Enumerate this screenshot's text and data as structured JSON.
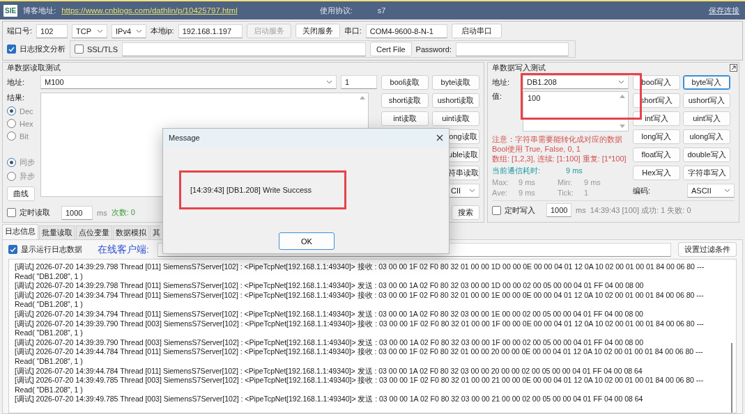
{
  "title_bar": {
    "logo": "SIE",
    "blog_label": "博客地址:",
    "blog_url": "https://www.cnblogs.com/dathlin/p/10425797.html",
    "protocol_label": "使用协议:",
    "protocol": "s7",
    "save_link": "保存连接"
  },
  "connection": {
    "port_label": "端口号:",
    "port": "102",
    "transport": "TCP",
    "ip_version": "IPv4",
    "local_ip_label": "本地ip:",
    "local_ip": "192.168.1.197",
    "buttons": [
      {
        "label": "启动服务",
        "disabled": true
      },
      {
        "label": "关闭服务",
        "disabled": false
      }
    ],
    "serial_label": "串口:",
    "serial": "COM4-9600-8-N-1",
    "serial_button": "启动串口",
    "log_analysis": {
      "label": "日志报文分析",
      "checked": true
    },
    "ssl": {
      "label": "SSL/TLS",
      "checked": false
    },
    "cert_button": "Cert File",
    "password_label": "Password:"
  },
  "read_test": {
    "title": "单数据读取测试",
    "address_label": "地址:",
    "address": "M100",
    "count": "1",
    "result_label": "结果:",
    "formats": [
      {
        "label": "Dec",
        "selected": true
      },
      {
        "label": "Hex",
        "selected": false
      },
      {
        "label": "Bit",
        "selected": false
      }
    ],
    "modes": [
      {
        "label": "同步",
        "selected": true
      },
      {
        "label": "异步",
        "selected": false
      }
    ],
    "curve_button": "曲线",
    "button_rows": [
      [
        "bool读取",
        "byte读取"
      ],
      [
        "short读取",
        "ushort读取"
      ],
      [
        "int读取",
        "uint读取"
      ],
      [
        "ong读取"
      ],
      [
        "uble读取"
      ],
      [
        "符串读取"
      ]
    ],
    "encoding": "CII",
    "timer": {
      "label": "定时读取",
      "checked": false,
      "interval": "1000",
      "unit": "ms",
      "count": "次数: 0"
    },
    "search_button": "搜索"
  },
  "write_test": {
    "title": "单数据写入测试",
    "address_label": "地址:",
    "address": "DB1.208",
    "value_label": "值:",
    "value": "100",
    "notes": [
      "注意：字符串需要能转化成对应的数据",
      "Bool使用 True, False, 0, 1",
      "数组: [1,2,3], 连续: [1:100] 重复: [1*100]"
    ],
    "elapsed_label": "当前通信耗时:",
    "elapsed": "9 ms",
    "stats": [
      {
        "label": "Max:",
        "value": "9 ms"
      },
      {
        "label": "Min:",
        "value": "9 ms"
      },
      {
        "label": "Ave:",
        "value": "9 ms"
      },
      {
        "label": "Tick:",
        "value": "1"
      }
    ],
    "buttons": [
      {
        "label": "bool写入",
        "focused": false
      },
      {
        "label": "byte写入",
        "focused": true
      },
      {
        "label": "short写入",
        "focused": false
      },
      {
        "label": "ushort写入",
        "focused": false
      },
      {
        "label": "int写入",
        "focused": false
      },
      {
        "label": "uint写入",
        "focused": false
      },
      {
        "label": "long写入",
        "focused": false
      },
      {
        "label": "ulong写入",
        "focused": false
      },
      {
        "label": "float写入",
        "focused": false
      },
      {
        "label": "double写入",
        "focused": false
      },
      {
        "label": "Hex写入",
        "focused": false
      },
      {
        "label": "字符串写入",
        "focused": false
      }
    ],
    "encoding_label": "编码:",
    "encoding": "ASCII",
    "timer": {
      "label": "定时写入",
      "checked": false,
      "interval": "1000",
      "unit": "ms",
      "status": "14:39:43 [100] 成功: 1 失败: 0"
    }
  },
  "tabs": [
    {
      "label": "日志信息",
      "selected": true
    },
    {
      "label": "批量读取",
      "selected": false
    },
    {
      "label": "点位变量",
      "selected": false
    },
    {
      "label": "数据模拟",
      "selected": false
    },
    {
      "label": "其",
      "selected": false
    }
  ],
  "log_options": {
    "show_log": {
      "label": "显示运行日志数据",
      "checked": true
    },
    "online_label": "在线客户端:",
    "filter_button": "设置过滤条件"
  },
  "log_lines": [
    "[调试] 2026-07-20 14:39:29.798 Thread [011] SiemensS7Server[102] : <PipeTcpNet[192.168.1.1:49340]> 接收 : 03 00 00 1F 02 F0 80 32 01 00 00 1D 00 00 0E 00 00 04 01 12 0A 10 02 00 01 00 01 84 00 06 80 ---",
    "Read( \"DB1.208\", 1 )",
    "[调试] 2026-07-20 14:39:29.798 Thread [011] SiemensS7Server[102] : <PipeTcpNet[192.168.1.1:49340]> 发送 : 03 00 00 1A 02 F0 80 32 03 00 00 1D 00 00 02 00 05 00 00 04 01 FF 04 00 08 00",
    "[调试] 2026-07-20 14:39:34.794 Thread [011] SiemensS7Server[102] : <PipeTcpNet[192.168.1.1:49340]> 接收 : 03 00 00 1F 02 F0 80 32 01 00 00 1E 00 00 0E 00 00 04 01 12 0A 10 02 00 01 00 01 84 00 06 80 ---",
    "Read( \"DB1.208\", 1 )",
    "[调试] 2026-07-20 14:39:34.794 Thread [011] SiemensS7Server[102] : <PipeTcpNet[192.168.1.1:49340]> 发送 : 03 00 00 1A 02 F0 80 32 03 00 00 1E 00 00 02 00 05 00 00 04 01 FF 04 00 08 00",
    "[调试] 2026-07-20 14:39:39.790 Thread [003] SiemensS7Server[102] : <PipeTcpNet[192.168.1.1:49340]> 接收 : 03 00 00 1F 02 F0 80 32 01 00 00 1F 00 00 0E 00 00 04 01 12 0A 10 02 00 01 00 01 84 00 06 80 ---",
    "Read( \"DB1.208\", 1 )",
    "[调试] 2026-07-20 14:39:39.790 Thread [003] SiemensS7Server[102] : <PipeTcpNet[192.168.1.1:49340]> 发送 : 03 00 00 1A 02 F0 80 32 03 00 00 1F 00 00 02 00 05 00 00 04 01 FF 04 00 08 00",
    "[调试] 2026-07-20 14:39:44.784 Thread [011] SiemensS7Server[102] : <PipeTcpNet[192.168.1.1:49340]> 接收 : 03 00 00 1F 02 F0 80 32 01 00 00 20 00 00 0E 00 00 04 01 12 0A 10 02 00 01 00 01 84 00 06 80 ---",
    "Read( \"DB1.208\", 1 )",
    "[调试] 2026-07-20 14:39:44.784 Thread [011] SiemensS7Server[102] : <PipeTcpNet[192.168.1.1:49340]> 发送 : 03 00 00 1A 02 F0 80 32 03 00 00 20 00 00 02 00 05 00 00 04 01 FF 04 00 08 64",
    "[调试] 2026-07-20 14:39:49.785 Thread [003] SiemensS7Server[102] : <PipeTcpNet[192.168.1.1:49340]> 接收 : 03 00 00 1F 02 F0 80 32 01 00 00 21 00 00 0E 00 00 04 01 12 0A 10 02 00 01 00 01 84 00 06 80 ---",
    "Read( \"DB1.208\", 1 )",
    "[调试] 2026-07-20 14:39:49.785 Thread [003] SiemensS7Server[102] : <PipeTcpNet[192.168.1.1:49340]> 发送 : 03 00 00 1A 02 F0 80 32 03 00 00 21 00 00 02 00 05 00 00 04 01 FF 04 00 08 64"
  ],
  "dialog": {
    "title": "Message",
    "message": "[14:39:43] [DB1.208] Write Success",
    "ok_button": "OK"
  }
}
